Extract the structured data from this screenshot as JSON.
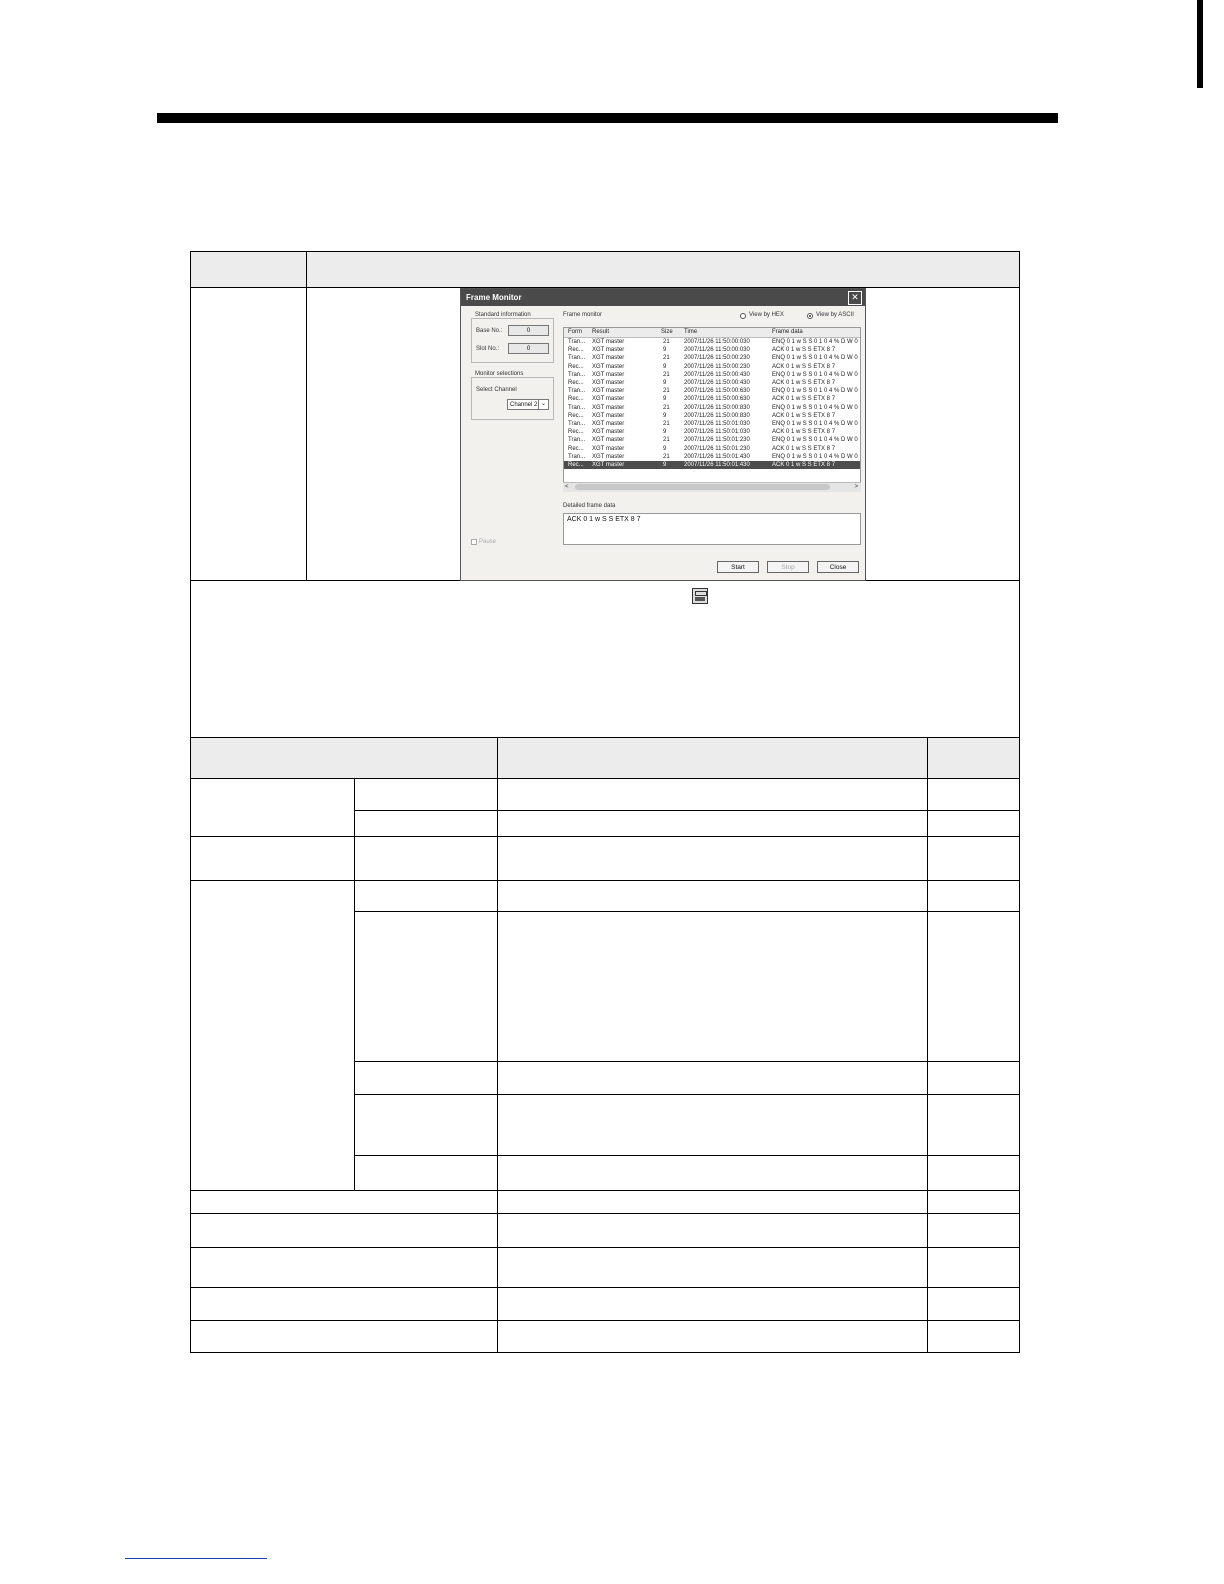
{
  "dialog": {
    "title": "Frame Monitor",
    "close_glyph": "✕",
    "standard_info": {
      "legend": "Standard information",
      "base_label": "Base No.:",
      "base_value": "0",
      "slot_label": "Slot No.:",
      "slot_value": "0"
    },
    "monitor_selections": {
      "legend": "Monitor selections",
      "channel_label": "Select Channel",
      "channel_value": "Channel 2"
    },
    "pause_label": "Pause",
    "frame_monitor_label": "Frame monitor",
    "view_hex_label": "View by HEX",
    "view_ascii_label": "View by ASCII",
    "columns": [
      "Form",
      "Result",
      "Size",
      "Time",
      "Frame data"
    ],
    "rows": [
      {
        "form": "Tran...",
        "result": "XGT master",
        "size": "21",
        "time": "2007/11/26 11:50:00:030",
        "data": "ENQ 0 1 w S S 0 1 0 4 % D W 0"
      },
      {
        "form": "Rec...",
        "result": "XGT master",
        "size": "9",
        "time": "2007/11/26 11:50:00:030",
        "data": "ACK 0 1 w S S ETX 8 7"
      },
      {
        "form": "Tran...",
        "result": "XGT master",
        "size": "21",
        "time": "2007/11/26 11:50:00:230",
        "data": "ENQ 0 1 w S S 0 1 0 4 % D W 0"
      },
      {
        "form": "Rec...",
        "result": "XGT master",
        "size": "9",
        "time": "2007/11/26 11:50:00:230",
        "data": "ACK 0 1 w S S ETX 8 7"
      },
      {
        "form": "Tran...",
        "result": "XGT master",
        "size": "21",
        "time": "2007/11/26 11:50:00:430",
        "data": "ENQ 0 1 w S S 0 1 0 4 % D W 0"
      },
      {
        "form": "Rec...",
        "result": "XGT master",
        "size": "9",
        "time": "2007/11/26 11:50:00:430",
        "data": "ACK 0 1 w S S ETX 8 7"
      },
      {
        "form": "Tran...",
        "result": "XGT master",
        "size": "21",
        "time": "2007/11/26 11:50:00:630",
        "data": "ENQ 0 1 w S S 0 1 0 4 % D W 0"
      },
      {
        "form": "Rec...",
        "result": "XGT master",
        "size": "9",
        "time": "2007/11/26 11:50:00:630",
        "data": "ACK 0 1 w S S ETX 8 7"
      },
      {
        "form": "Tran...",
        "result": "XGT master",
        "size": "21",
        "time": "2007/11/26 11:50:00:830",
        "data": "ENQ 0 1 w S S 0 1 0 4 % D W 0"
      },
      {
        "form": "Rec...",
        "result": "XGT master",
        "size": "9",
        "time": "2007/11/26 11:50:00:830",
        "data": "ACK 0 1 w S S ETX 8 7"
      },
      {
        "form": "Tran...",
        "result": "XGT master",
        "size": "21",
        "time": "2007/11/26 11:50:01:030",
        "data": "ENQ 0 1 w S S 0 1 0 4 % D W 0"
      },
      {
        "form": "Rec...",
        "result": "XGT master",
        "size": "9",
        "time": "2007/11/26 11:50:01:030",
        "data": "ACK 0 1 w S S ETX 8 7"
      },
      {
        "form": "Tran...",
        "result": "XGT master",
        "size": "21",
        "time": "2007/11/26 11:50:01:230",
        "data": "ENQ 0 1 w S S 0 1 0 4 % D W 0"
      },
      {
        "form": "Rec...",
        "result": "XGT master",
        "size": "9",
        "time": "2007/11/26 11:50:01:230",
        "data": "ACK 0 1 w S S ETX 8 7"
      },
      {
        "form": "Tran...",
        "result": "XGT master",
        "size": "21",
        "time": "2007/11/26 11:50:01:430",
        "data": "ENQ 0 1 w S S 0 1 0 4 % D W 0"
      },
      {
        "form": "Rec...",
        "result": "XGT master",
        "size": "9",
        "time": "2007/11/26 11:50:01:430",
        "data": "ACK 0 1 w S S ETX 8 7"
      }
    ],
    "selected_row": 15,
    "detail_label": "Detailed frame data",
    "detail_value": "ACK 0 1 w S S ETX 8 7",
    "buttons": {
      "start": "Start",
      "stop": "Stop",
      "close": "Close"
    }
  }
}
